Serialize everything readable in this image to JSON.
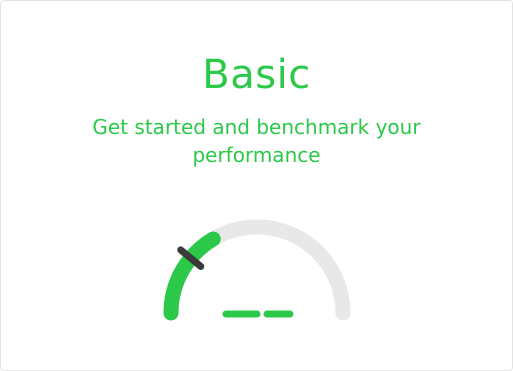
{
  "plan": {
    "title": "Basic",
    "subtitle": "Get started and benchmark your performance"
  },
  "gauge": {
    "level_fraction": 0.33,
    "needle_fraction": 0.22,
    "value_placeholder": "– –"
  },
  "colors": {
    "accent": "#2cc84a",
    "track": "#e8e8e8",
    "needle": "#3a3a3a"
  },
  "icons": {
    "gauge": "speedometer-gauge-icon"
  }
}
